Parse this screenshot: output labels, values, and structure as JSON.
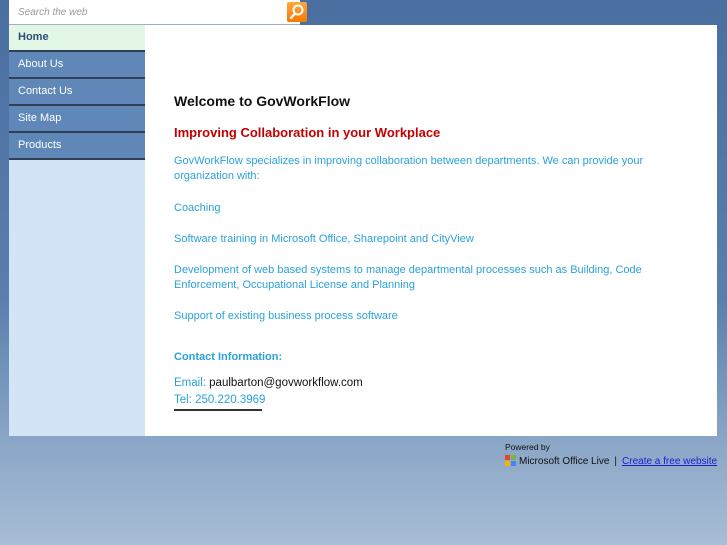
{
  "search": {
    "placeholder": "Search the web",
    "value": ""
  },
  "nav": {
    "items": [
      {
        "label": "Home",
        "active": true
      },
      {
        "label": "About Us"
      },
      {
        "label": "Contact Us"
      },
      {
        "label": "Site Map"
      },
      {
        "label": "Products"
      }
    ]
  },
  "main": {
    "title": "Welcome to GovWorkFlow",
    "subtitle": "Improving Collaboration in your Workplace",
    "intro": "GovWorkFlow specializes in improving collaboration between departments. We can provide your organization with:",
    "services": [
      "Coaching",
      "Software training in Microsoft Office, Sharepoint and CityView",
      "Development of web based systems to manage departmental processes such as Building, Code Enforcement, Occupational License and Planning",
      "Support of existing business process software"
    ],
    "contact": {
      "heading": "Contact Information:",
      "email_label": "Email:",
      "email_value": "paulbarton@govworkflow.com",
      "tel_label": "Tel:",
      "tel_value": "250.220.3969"
    }
  },
  "footer": {
    "powered_by": "Powered by",
    "brand": "Microsoft Office Live",
    "separator": "|",
    "link": "Create a free website"
  },
  "colors": {
    "accent_orange": "#f47a00",
    "heading_red": "#c40000",
    "text_blue": "#2aa2d8",
    "nav_blue": "#5f87b8"
  }
}
